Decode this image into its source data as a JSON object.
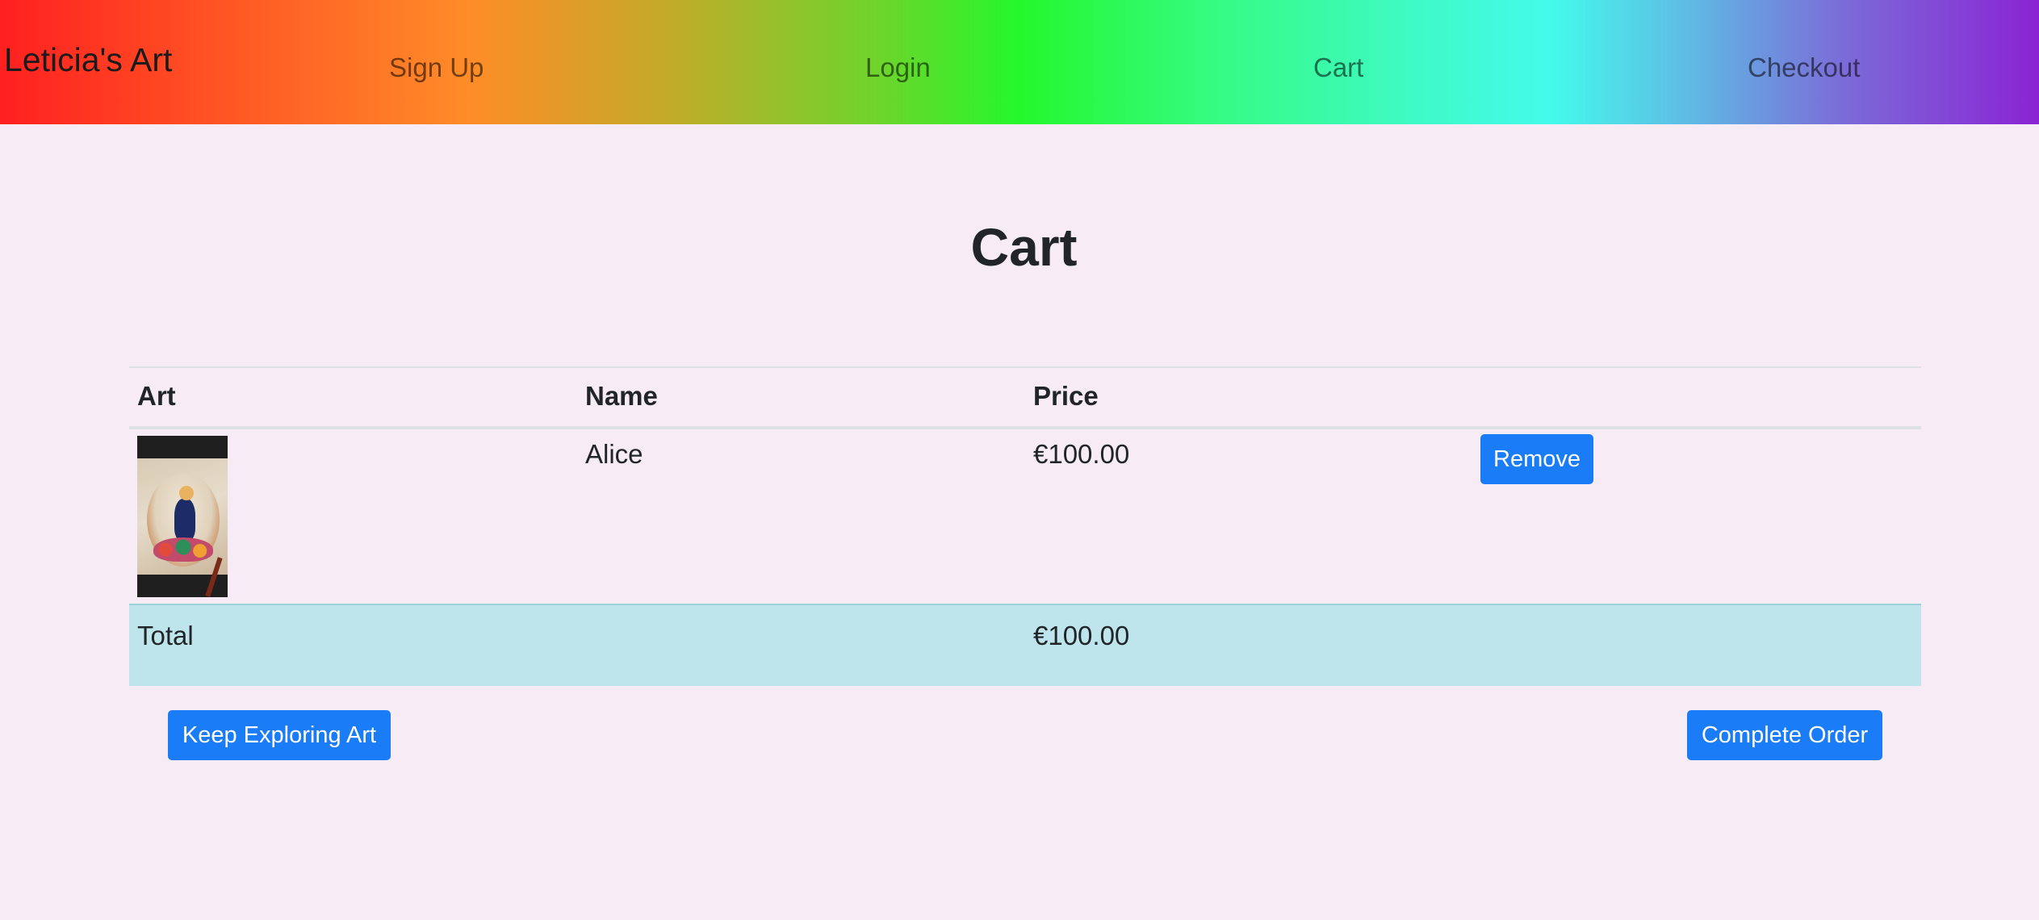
{
  "navbar": {
    "brand": "Leticia's Art",
    "links": [
      {
        "label": "Sign Up"
      },
      {
        "label": "Login"
      },
      {
        "label": "Cart"
      },
      {
        "label": "Checkout"
      }
    ]
  },
  "page": {
    "title": "Cart"
  },
  "table": {
    "headers": [
      "Art",
      "Name",
      "Price",
      ""
    ],
    "rows": [
      {
        "art_icon": "artwork-thumbnail",
        "name": "Alice",
        "price": "€100.00",
        "action_label": "Remove"
      }
    ],
    "total": {
      "label": "Total",
      "price": "€100.00"
    }
  },
  "actions": {
    "keep_exploring_label": "Keep Exploring Art",
    "complete_order_label": "Complete Order"
  },
  "colors": {
    "page_background": "#f7ecf5",
    "primary_button": "#1a7cf6",
    "total_row": "#bee5eb",
    "navbar_gradient": [
      "#ff2020",
      "#ff8c28",
      "#24f82c",
      "#44fbea",
      "#8a23d4"
    ]
  }
}
